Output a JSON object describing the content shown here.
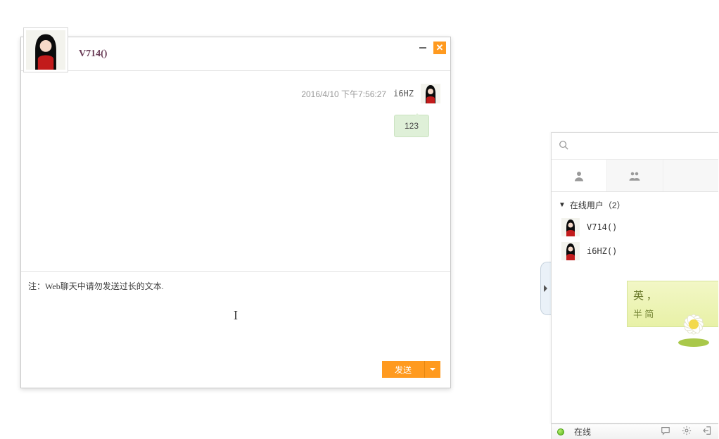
{
  "chat": {
    "title": "V714()",
    "minimize_label": "minimize",
    "close_label": "close",
    "messages": [
      {
        "timestamp": "2016/4/10 下午7:56:27",
        "sender": "i6HZ",
        "text": "123",
        "outgoing": true
      }
    ],
    "input_hint": "注：Web聊天中请勿发送过长的文本.",
    "send_label": "发送"
  },
  "side": {
    "search_placeholder": "",
    "group_header": "在线用户（2）",
    "users": [
      {
        "name": "V714()"
      },
      {
        "name": "i6HZ()"
      }
    ],
    "ime": {
      "line1": "英 ，",
      "line2": "半 简"
    }
  },
  "status": {
    "label": "在线"
  }
}
